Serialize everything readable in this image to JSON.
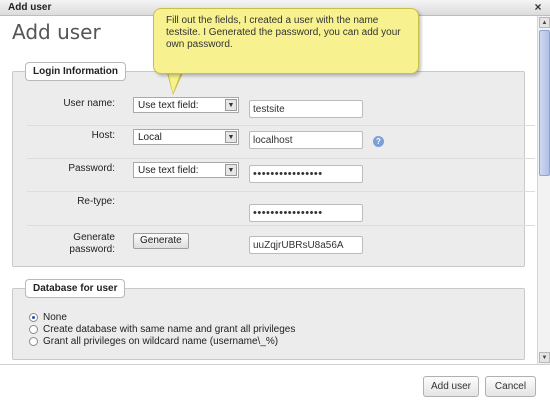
{
  "window": {
    "title": "Add user",
    "close_glyph": "×"
  },
  "heading": "Add user",
  "login_info": {
    "legend": "Login Information",
    "username": {
      "label": "User name:",
      "select": "Use text field:",
      "value": "testsite"
    },
    "host": {
      "label": "Host:",
      "select": "Local",
      "value": "localhost",
      "help_icon": "help-icon"
    },
    "password": {
      "label": "Password:",
      "select": "Use text field:",
      "value": "••••••••••••••••"
    },
    "retype": {
      "label": "Re-type:",
      "value": "••••••••••••••••"
    },
    "generate": {
      "label_line1": "Generate",
      "label_line2": "password:",
      "button": "Generate",
      "value": "uuZqjrUBRsU8a56A"
    }
  },
  "database": {
    "legend": "Database for user",
    "options": [
      {
        "label": "None",
        "checked": true
      },
      {
        "label": "Create database with same name and grant all privileges",
        "checked": false
      },
      {
        "label": "Grant all privileges on wildcard name (username\\_%)",
        "checked": false
      }
    ]
  },
  "tooltip": {
    "text": "Fill out the fields, I created a user with the name testsite. I Generated the password, you can add your own password."
  },
  "footer": {
    "add_user": "Add user",
    "cancel": "Cancel"
  },
  "colors": {
    "tooltip_bg": "#f7f28f",
    "panel_bg": "#ececec",
    "scroll_thumb": "#aec0e4"
  }
}
